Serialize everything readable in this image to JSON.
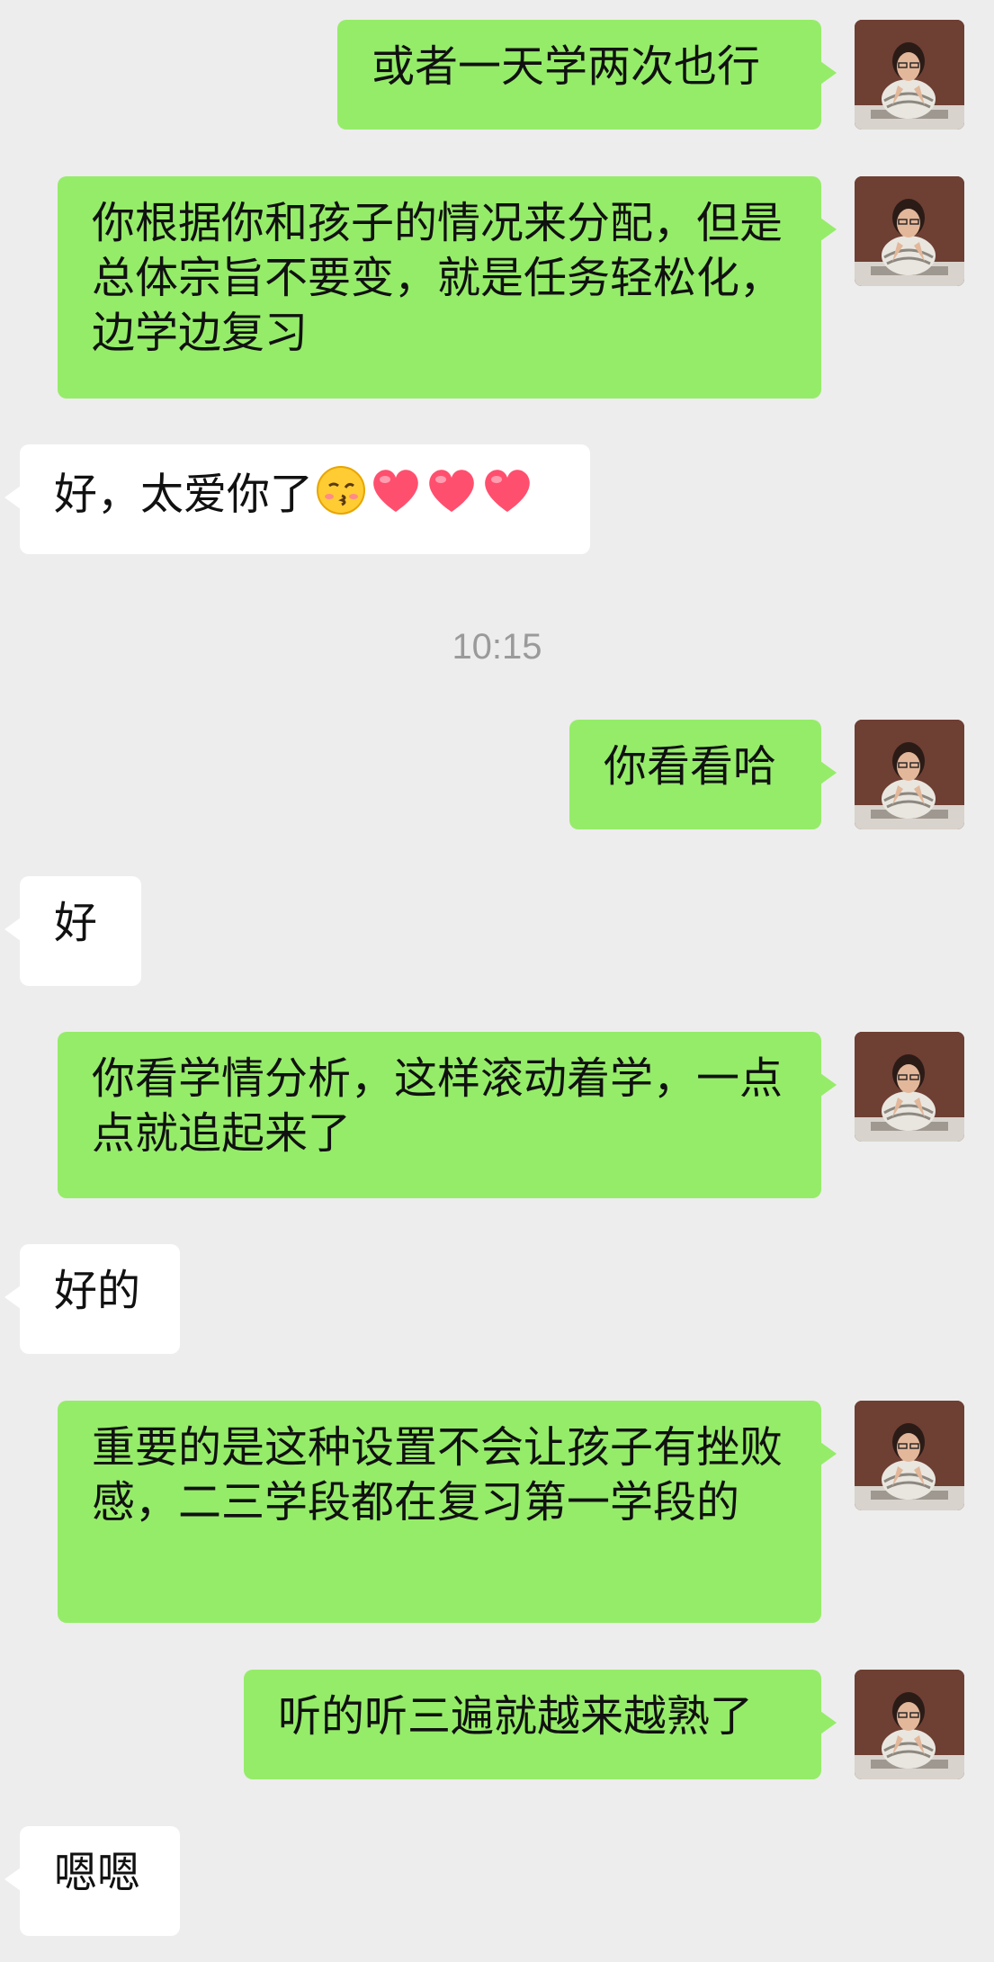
{
  "chat": {
    "timestamp": "10:15",
    "messages": [
      {
        "side": "out",
        "text": "或者一天学两次也行"
      },
      {
        "side": "out",
        "text": "你根据你和孩子的情况来分配，但是总体宗旨不要变，就是任务轻松化，边学边复习"
      },
      {
        "side": "in",
        "text": "好，太爱你了",
        "emojis": [
          "kissing-face-icon",
          "heart-icon",
          "heart-icon",
          "heart-icon"
        ]
      },
      {
        "side": "out",
        "text": "你看看哈"
      },
      {
        "side": "in",
        "text": "好"
      },
      {
        "side": "out",
        "text": "你看学情分析，这样滚动着学，一点点就追起来了"
      },
      {
        "side": "in",
        "text": "好的"
      },
      {
        "side": "out",
        "text": "重要的是这种设置不会让孩子有挫败感，二三学段都在复习第一学段的"
      },
      {
        "side": "out",
        "text": "听的听三遍就越来越熟了"
      },
      {
        "side": "in",
        "text": "嗯嗯"
      }
    ]
  },
  "colors": {
    "outgoing": "#95ec69",
    "incoming": "#ffffff",
    "background": "#ededed",
    "timestamp": "#9a9a9a"
  }
}
